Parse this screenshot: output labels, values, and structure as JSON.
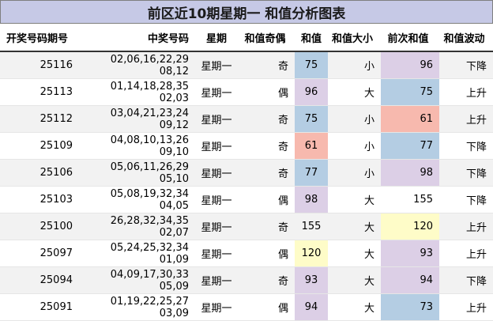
{
  "title": "前区近10期星期一 和值分析图表",
  "headers": {
    "qihao": "开奖号码期号",
    "haoma": "中奖号码",
    "xingqi": "星期",
    "jiou": "和值奇偶",
    "hezhi": "和值",
    "daxiao": "和值大小",
    "qianci": "前次和值",
    "bodong": "和值波动"
  },
  "colors": {
    "title_bg": "#c6c9e6",
    "blue": "#b4cde3",
    "purple": "#dccfe6",
    "red": "#f7b9ae",
    "yellow": "#fefcc8",
    "stripe": "#f2f2f2"
  },
  "rows": [
    {
      "qihao": "25116",
      "haoma": "02,06,16,22,29 08,12",
      "xingqi": "星期一",
      "jiou": "奇",
      "hezhi": "75",
      "hezhi_hl": "blue",
      "daxiao": "小",
      "qianci": "96",
      "qianci_hl": "purple",
      "bodong": "下降"
    },
    {
      "qihao": "25113",
      "haoma": "01,14,18,28,35 02,03",
      "xingqi": "星期一",
      "jiou": "偶",
      "hezhi": "96",
      "hezhi_hl": "purple",
      "daxiao": "大",
      "qianci": "75",
      "qianci_hl": "blue",
      "bodong": "上升"
    },
    {
      "qihao": "25112",
      "haoma": "03,04,21,23,24 09,12",
      "xingqi": "星期一",
      "jiou": "奇",
      "hezhi": "75",
      "hezhi_hl": "blue",
      "daxiao": "小",
      "qianci": "61",
      "qianci_hl": "red",
      "bodong": "上升"
    },
    {
      "qihao": "25109",
      "haoma": "04,08,10,13,26 09,10",
      "xingqi": "星期一",
      "jiou": "奇",
      "hezhi": "61",
      "hezhi_hl": "red",
      "daxiao": "小",
      "qianci": "77",
      "qianci_hl": "blue",
      "bodong": "下降"
    },
    {
      "qihao": "25106",
      "haoma": "05,06,11,26,29 05,10",
      "xingqi": "星期一",
      "jiou": "奇",
      "hezhi": "77",
      "hezhi_hl": "blue",
      "daxiao": "小",
      "qianci": "98",
      "qianci_hl": "purple",
      "bodong": "下降"
    },
    {
      "qihao": "25103",
      "haoma": "05,08,19,32,34 04,05",
      "xingqi": "星期一",
      "jiou": "偶",
      "hezhi": "98",
      "hezhi_hl": "purple",
      "daxiao": "大",
      "qianci": "155",
      "qianci_hl": "",
      "bodong": "下降"
    },
    {
      "qihao": "25100",
      "haoma": "26,28,32,34,35 02,07",
      "xingqi": "星期一",
      "jiou": "奇",
      "hezhi": "155",
      "hezhi_hl": "",
      "daxiao": "大",
      "qianci": "120",
      "qianci_hl": "yellow",
      "bodong": "上升"
    },
    {
      "qihao": "25097",
      "haoma": "05,24,25,32,34 01,09",
      "xingqi": "星期一",
      "jiou": "偶",
      "hezhi": "120",
      "hezhi_hl": "yellow",
      "daxiao": "大",
      "qianci": "93",
      "qianci_hl": "purple",
      "bodong": "上升"
    },
    {
      "qihao": "25094",
      "haoma": "04,09,17,30,33 05,09",
      "xingqi": "星期一",
      "jiou": "奇",
      "hezhi": "93",
      "hezhi_hl": "purple",
      "daxiao": "大",
      "qianci": "94",
      "qianci_hl": "purple",
      "bodong": "下降"
    },
    {
      "qihao": "25091",
      "haoma": "01,19,22,25,27 03,09",
      "xingqi": "星期一",
      "jiou": "偶",
      "hezhi": "94",
      "hezhi_hl": "purple",
      "daxiao": "大",
      "qianci": "73",
      "qianci_hl": "blue",
      "bodong": "上升"
    }
  ]
}
